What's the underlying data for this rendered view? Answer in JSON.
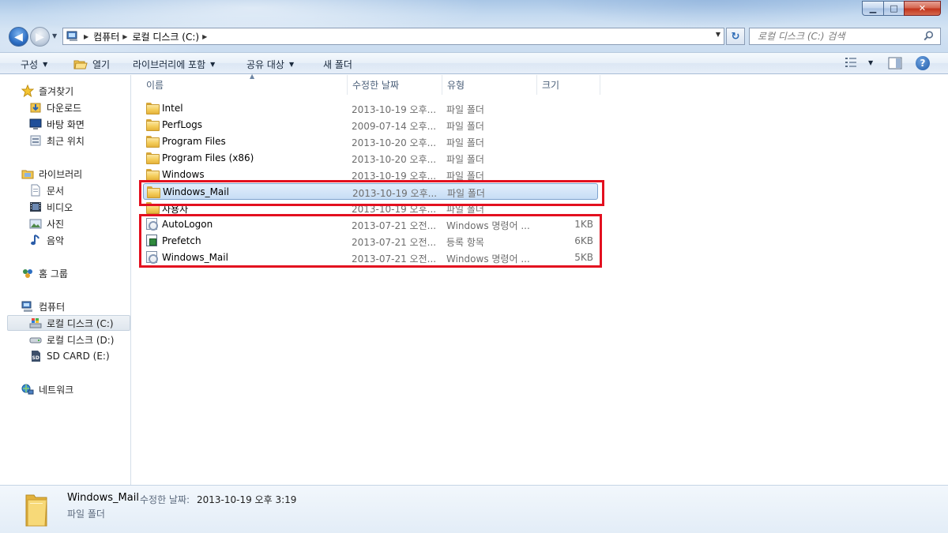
{
  "window": {
    "minimize_label": "▁",
    "maximize_label": "□",
    "close_label": "✕"
  },
  "address": {
    "crumbs": [
      "컴퓨터",
      "로컬 디스크 (C:)"
    ]
  },
  "search": {
    "placeholder": "로컬 디스크 (C:) 검색"
  },
  "toolbar": {
    "organize": "구성",
    "open": "열기",
    "include_library": "라이브러리에 포함",
    "share": "공유 대상",
    "new_folder": "새 폴더",
    "help": "?"
  },
  "nav": {
    "favorites": "즐겨찾기",
    "downloads": "다운로드",
    "desktop": "바탕 화면",
    "recent": "최근 위치",
    "libraries": "라이브러리",
    "documents": "문서",
    "videos": "비디오",
    "pictures": "사진",
    "music": "음악",
    "homegroup": "홈 그룹",
    "computer": "컴퓨터",
    "drive_c": "로컬 디스크 (C:)",
    "drive_d": "로컬 디스크 (D:)",
    "drive_e": "SD CARD (E:)",
    "network": "네트워크"
  },
  "columns": {
    "name": "이름",
    "modified": "수정한 날짜",
    "type": "유형",
    "size": "크기"
  },
  "files": [
    {
      "name": "Intel",
      "date": "2013-10-19 오후...",
      "type": "파일 폴더",
      "size": "",
      "icon": "folder-icon"
    },
    {
      "name": "PerfLogs",
      "date": "2009-07-14 오후...",
      "type": "파일 폴더",
      "size": "",
      "icon": "folder-icon"
    },
    {
      "name": "Program Files",
      "date": "2013-10-20 오후...",
      "type": "파일 폴더",
      "size": "",
      "icon": "folder-icon"
    },
    {
      "name": "Program Files (x86)",
      "date": "2013-10-20 오후...",
      "type": "파일 폴더",
      "size": "",
      "icon": "folder-icon"
    },
    {
      "name": "Windows",
      "date": "2013-10-19 오후...",
      "type": "파일 폴더",
      "size": "",
      "icon": "folder-icon"
    },
    {
      "name": "Windows_Mail",
      "date": "2013-10-19 오후...",
      "type": "파일 폴더",
      "size": "",
      "icon": "folder-icon",
      "selected": true
    },
    {
      "name": "사용자",
      "date": "2013-10-19 오후...",
      "type": "파일 폴더",
      "size": "",
      "icon": "folder-icon"
    },
    {
      "name": "AutoLogon",
      "date": "2013-07-21 오전...",
      "type": "Windows 명령어 ...",
      "size": "1KB",
      "icon": "cmd-script-icon"
    },
    {
      "name": "Prefetch",
      "date": "2013-07-21 오전...",
      "type": "등록 항목",
      "size": "6KB",
      "icon": "registry-file-icon"
    },
    {
      "name": "Windows_Mail",
      "date": "2013-07-21 오전...",
      "type": "Windows 명령어 ...",
      "size": "5KB",
      "icon": "cmd-script-icon"
    }
  ],
  "details": {
    "name": "Windows_Mail",
    "modified_label": "수정한 날짜:",
    "modified_value": "2013-10-19 오후 3:19",
    "type": "파일 폴더"
  },
  "colors": {
    "highlight": "#e3101f",
    "selection": "#c7ddf5",
    "accent": "#2e6fc4"
  }
}
